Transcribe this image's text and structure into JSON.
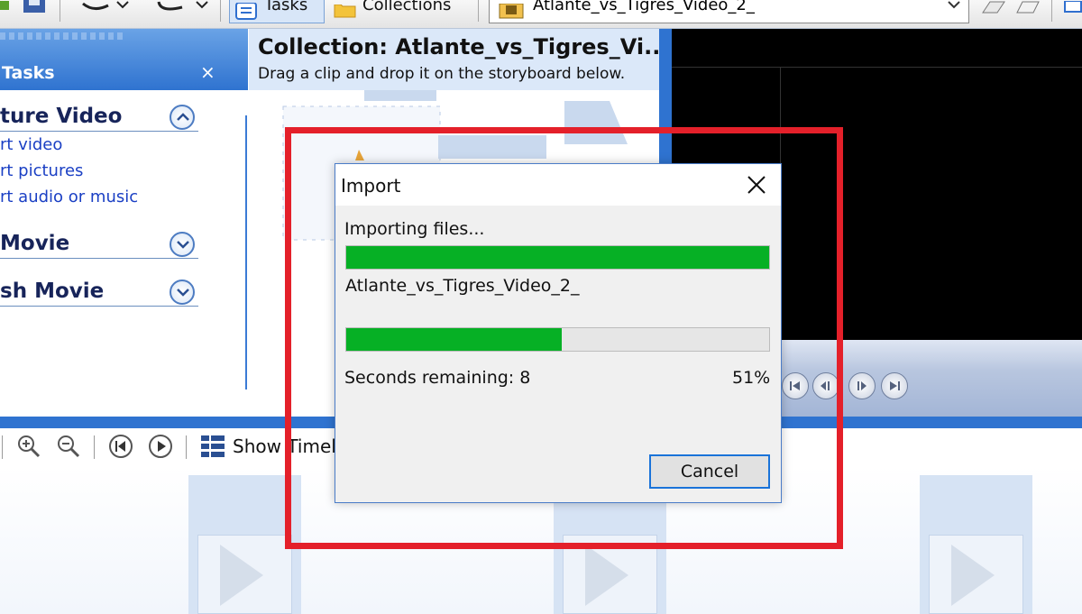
{
  "toolbar": {
    "tasks_label": "Tasks",
    "collections_label": "Collections",
    "collection_combo_value": "Atlante_vs_Tigres_Video_2_"
  },
  "task_pane": {
    "header_title": "Tasks",
    "close_glyph": "×",
    "sections": [
      {
        "title": "ture Video",
        "links": [
          "rt video",
          "rt pictures",
          "rt audio or music"
        ]
      },
      {
        "title": "Movie"
      },
      {
        "title": "sh Movie"
      }
    ]
  },
  "collection": {
    "title": "Collection: Atlante_vs_Tigres_Vi...",
    "subtitle": "Drag a clip and drop it on the storyboard below."
  },
  "timeline_toolbar": {
    "show_timeline_label": "Show Timel"
  },
  "import_dialog": {
    "title": "Import",
    "status": "Importing files...",
    "file_name": "Atlante_vs_Tigres_Video_2_",
    "overall_progress": 1.0,
    "file_progress": 0.51,
    "remaining_text": "Seconds remaining: 8",
    "percent_text": "51%",
    "cancel_label": "Cancel"
  },
  "colors": {
    "progress_green": "#06b025",
    "highlight_red": "#e4202a",
    "pane_blue": "#2f73d0"
  },
  "icons": [
    "save-icon",
    "undo-icon",
    "redo-icon",
    "tasks-icon",
    "collections-folder-icon",
    "film-icon",
    "chevron-down-icon",
    "close-icon",
    "chevron-up-icon",
    "zoom-in-icon",
    "zoom-out-icon",
    "rewind-icon",
    "play-icon",
    "timeline-icon",
    "storyboard-arrow-icon"
  ]
}
